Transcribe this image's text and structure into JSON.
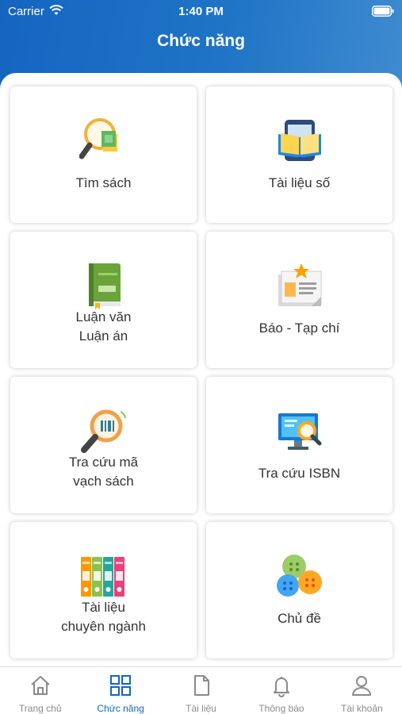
{
  "status": {
    "carrier": "Carrier",
    "time": "1:40 PM"
  },
  "header": {
    "title": "Chức năng"
  },
  "tiles": [
    {
      "label": "Tìm sách",
      "icon": "magnifier-book-icon"
    },
    {
      "label": "Tài liệu số",
      "icon": "tablet-book-icon"
    },
    {
      "label_line1": "Luận văn",
      "label_line2": "Luận án",
      "icon": "green-book-icon"
    },
    {
      "label": "Báo - Tạp chí",
      "icon": "newspaper-icon"
    },
    {
      "label_line1": "Tra cứu mã",
      "label_line2": "vạch sách",
      "icon": "barcode-search-icon"
    },
    {
      "label": "Tra cứu ISBN",
      "icon": "monitor-search-icon"
    },
    {
      "label_line1": "Tài liệu",
      "label_line2": "chuyên ngành",
      "icon": "binders-icon"
    },
    {
      "label": "Chủ đề",
      "icon": "buttons-icon"
    }
  ],
  "tabbar": {
    "active_color": "#1565c0",
    "items": [
      {
        "label": "Trang chủ",
        "icon": "home-icon"
      },
      {
        "label": "Chức năng",
        "icon": "grid-icon",
        "active": true
      },
      {
        "label": "Tài liệu",
        "icon": "document-icon"
      },
      {
        "label": "Thông báo",
        "icon": "bell-icon"
      },
      {
        "label": "Tài khoản",
        "icon": "user-icon"
      }
    ]
  }
}
